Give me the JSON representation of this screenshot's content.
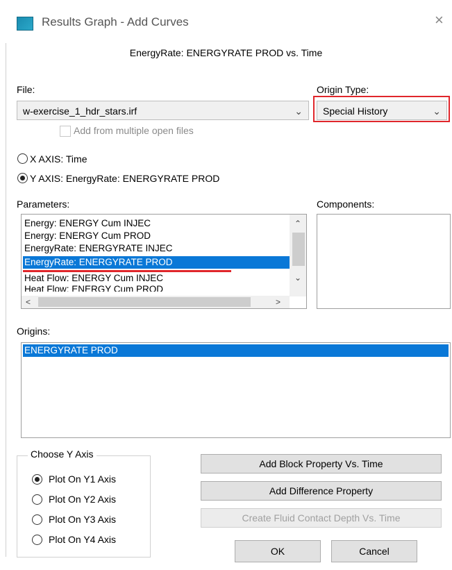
{
  "window": {
    "title": "Results Graph - Add Curves",
    "close_glyph": "×"
  },
  "subtitle": "EnergyRate: ENERGYRATE PROD vs. Time",
  "file": {
    "label": "File:",
    "value": "w-exercise_1_hdr_stars.irf"
  },
  "origin_type": {
    "label": "Origin Type:",
    "value": "Special History"
  },
  "add_multiple": {
    "label": "Add from multiple open files"
  },
  "axes": {
    "x_axis_label": "X AXIS:  Time",
    "y_axis_label": "Y AXIS:  EnergyRate: ENERGYRATE PROD",
    "selected": "y"
  },
  "parameters": {
    "label": "Parameters:",
    "items": [
      "Energy: ENERGY Cum INJEC",
      "Energy: ENERGY Cum PROD",
      "EnergyRate: ENERGYRATE INJEC",
      "EnergyRate: ENERGYRATE PROD",
      "Heat Flow: ENERGY Cum INJEC",
      "Heat Flow: ENERGY Cum PROD"
    ],
    "selected_index": 3
  },
  "components": {
    "label": "Components:"
  },
  "origins": {
    "label": "Origins:",
    "items": [
      "ENERGYRATE PROD"
    ],
    "selected_index": 0
  },
  "y_axis_group": {
    "title": "Choose Y Axis",
    "options": [
      "Plot On Y1 Axis",
      "Plot On Y2 Axis",
      "Plot On Y3 Axis",
      "Plot On Y4 Axis"
    ],
    "selected_index": 0
  },
  "buttons": {
    "add_block": "Add Block Property Vs. Time",
    "add_difference": "Add Difference Property",
    "create_fluid": "Create Fluid Contact Depth Vs. Time",
    "ok": "OK",
    "cancel": "Cancel"
  },
  "icons": [
    "app-icon",
    "close-icon",
    "chevron-down-icon",
    "scroll-up-icon",
    "scroll-down-icon",
    "scroll-left-icon",
    "scroll-right-icon"
  ],
  "colors": {
    "selection": "#0a78d7",
    "highlight_red": "#e0262b"
  }
}
